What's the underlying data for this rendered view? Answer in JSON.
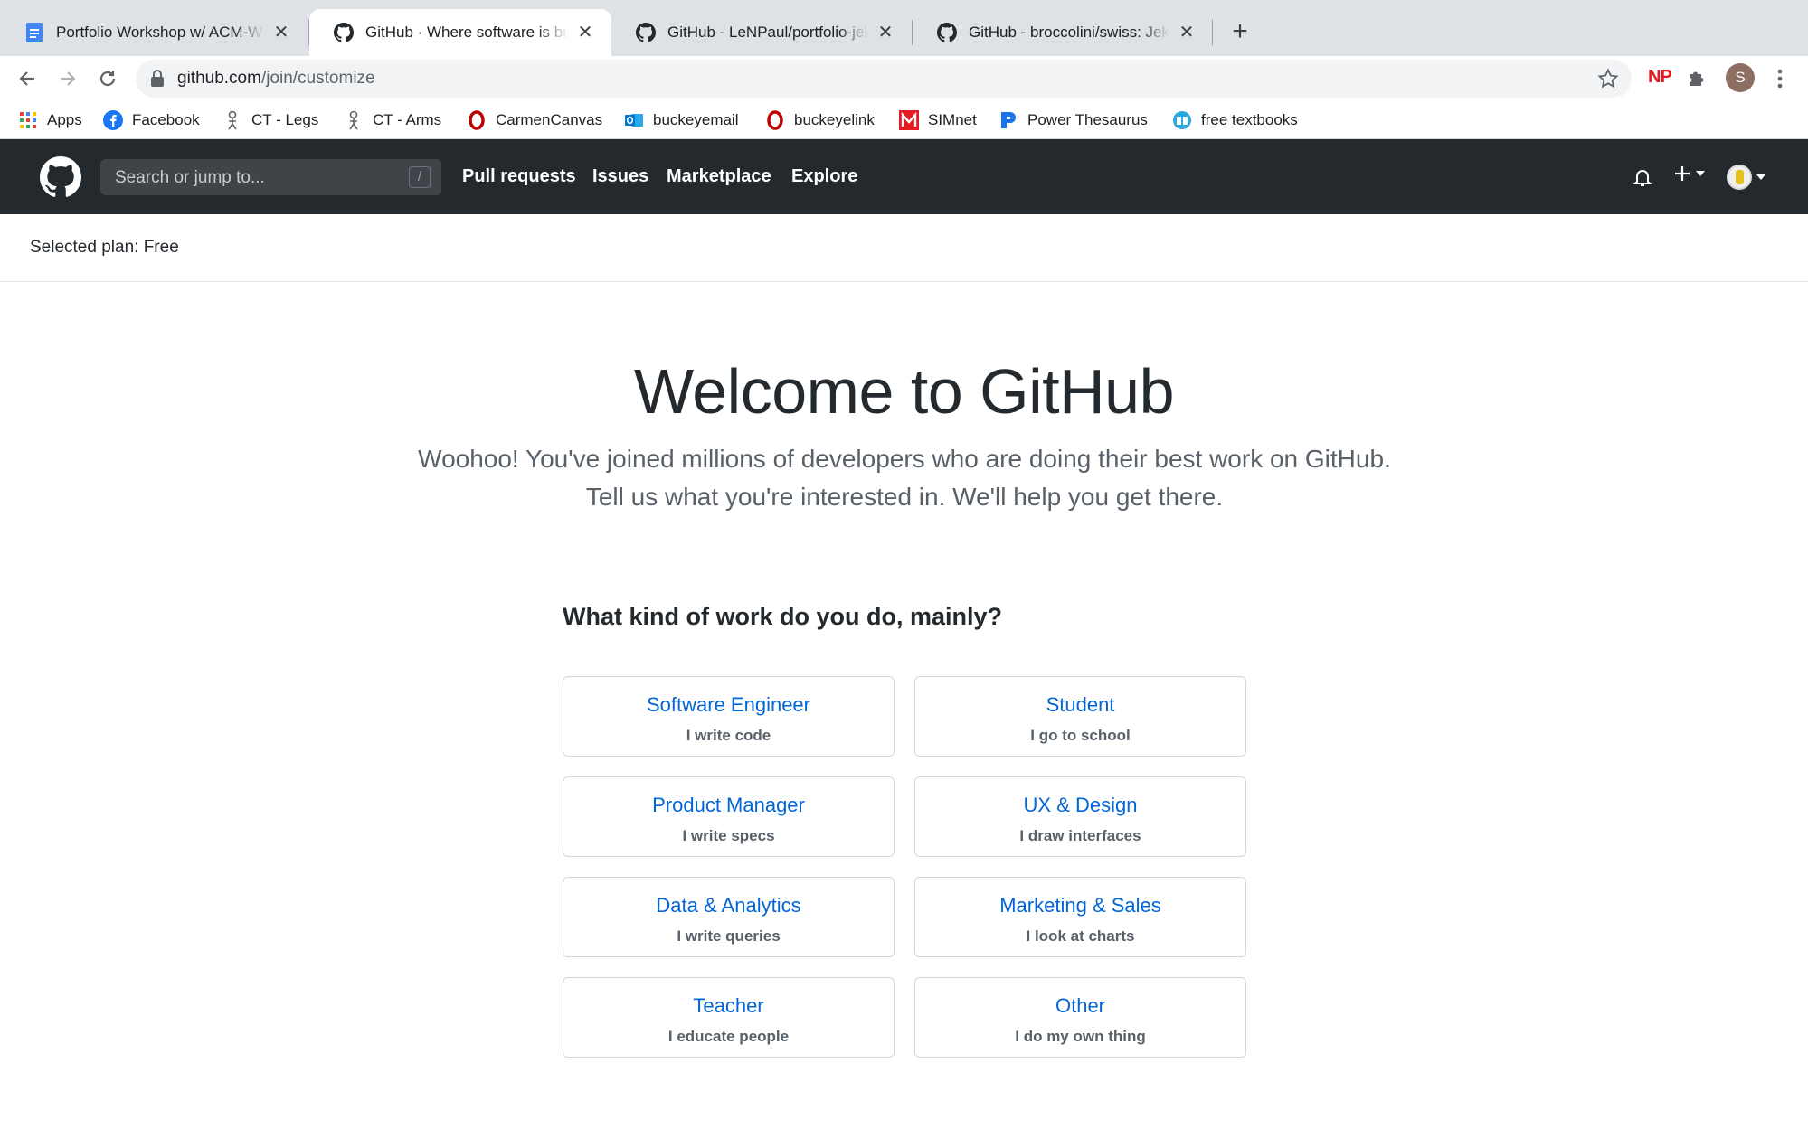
{
  "browser": {
    "tabs": [
      {
        "title": "Portfolio Workshop w/ ACM-W",
        "favicon": "google-docs-icon",
        "active": false
      },
      {
        "title": "GitHub · Where software is built",
        "favicon": "github-icon",
        "active": true
      },
      {
        "title": "GitHub - LeNPaul/portfolio-jekyll",
        "favicon": "github-icon",
        "active": false
      },
      {
        "title": "GitHub - broccolini/swiss: Jekyll",
        "favicon": "github-icon",
        "active": false
      }
    ],
    "close_glyph": "✕",
    "new_tab_glyph": "+",
    "url_host": "github.com",
    "url_path": "/join/customize",
    "ext_np": "NP",
    "profile_initial": "S",
    "bookmarks": [
      {
        "label": "Apps",
        "icon": "apps-grid-icon"
      },
      {
        "label": "Facebook",
        "icon": "facebook-icon"
      },
      {
        "label": "CT - Legs",
        "icon": "skeleton-icon"
      },
      {
        "label": "CT - Arms",
        "icon": "skeleton-icon"
      },
      {
        "label": "CarmenCanvas",
        "icon": "ohio-state-icon"
      },
      {
        "label": "buckeyemail",
        "icon": "outlook-icon"
      },
      {
        "label": "buckeyelink",
        "icon": "ohio-state-icon"
      },
      {
        "label": "SIMnet",
        "icon": "mcgraw-hill-icon"
      },
      {
        "label": "Power Thesaurus",
        "icon": "power-thesaurus-icon"
      },
      {
        "label": "free textbooks",
        "icon": "textbook-icon"
      }
    ]
  },
  "github": {
    "search_placeholder": "Search or jump to...",
    "search_hotkey": "/",
    "nav": [
      "Pull requests",
      "Issues",
      "Marketplace",
      "Explore"
    ]
  },
  "plan": {
    "text": "Selected plan: Free"
  },
  "main": {
    "title": "Welcome to GitHub",
    "subtitle": "Woohoo! You've joined millions of developers who are doing their best work on GitHub. Tell us what you're interested in. We'll help you get there.",
    "question": "What kind of work do you do, mainly?",
    "options": [
      {
        "title": "Software Engineer",
        "subtitle": "I write code"
      },
      {
        "title": "Student",
        "subtitle": "I go to school"
      },
      {
        "title": "Product Manager",
        "subtitle": "I write specs"
      },
      {
        "title": "UX & Design",
        "subtitle": "I draw interfaces"
      },
      {
        "title": "Data & Analytics",
        "subtitle": "I write queries"
      },
      {
        "title": "Marketing & Sales",
        "subtitle": "I look at charts"
      },
      {
        "title": "Teacher",
        "subtitle": "I educate people"
      },
      {
        "title": "Other",
        "subtitle": "I do my own thing"
      }
    ]
  },
  "colors": {
    "header_bg": "#24292e",
    "link_blue": "#0366d6",
    "muted_text": "#586069",
    "tabstrip_bg": "#dee1e6"
  }
}
